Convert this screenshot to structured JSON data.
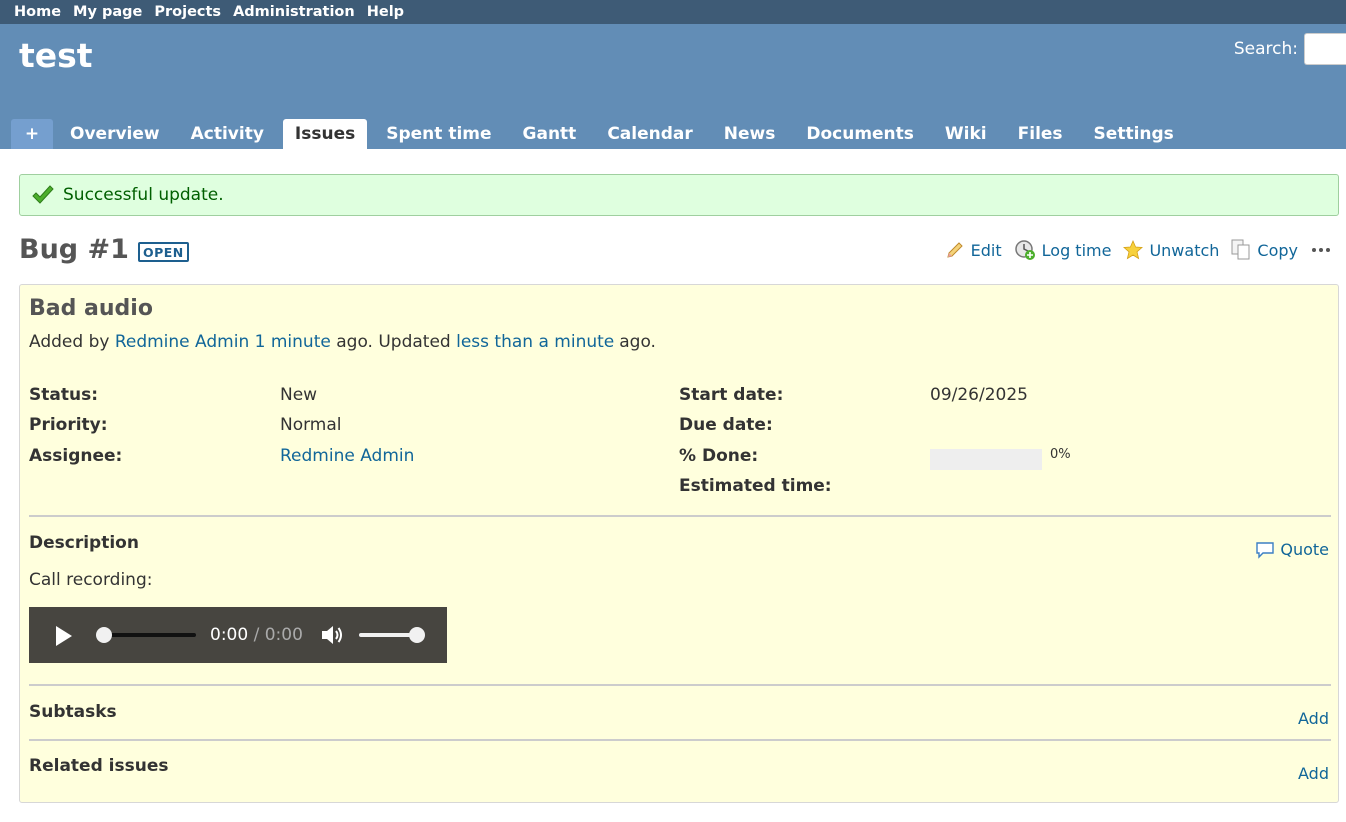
{
  "top_menu": [
    "Home",
    "My page",
    "Projects",
    "Administration",
    "Help"
  ],
  "project_title": "test",
  "search": {
    "label": "Search:"
  },
  "main_menu": {
    "new_label": "+",
    "tabs": [
      "Overview",
      "Activity",
      "Issues",
      "Spent time",
      "Gantt",
      "Calendar",
      "News",
      "Documents",
      "Wiki",
      "Files",
      "Settings"
    ],
    "selected": "Issues"
  },
  "flash": {
    "message": "Successful update."
  },
  "issue": {
    "title": "Bug #1",
    "status_badge": "OPEN",
    "subject": "Bad audio",
    "author": {
      "prefix": "Added by",
      "name": "Redmine Admin",
      "added_ago": "1 minute",
      "middle": "ago. Updated",
      "updated_ago": "less than a minute",
      "suffix": "ago."
    },
    "attributes_left": [
      {
        "label": "Status:",
        "value": "New",
        "link": false
      },
      {
        "label": "Priority:",
        "value": "Normal",
        "link": false
      },
      {
        "label": "Assignee:",
        "value": "Redmine Admin",
        "link": true
      }
    ],
    "attributes_right": [
      {
        "label": "Start date:",
        "value": "09/26/2025"
      },
      {
        "label": "Due date:",
        "value": ""
      },
      {
        "label": "% Done:",
        "value": "0%",
        "progress": 0
      },
      {
        "label": "Estimated time:",
        "value": ""
      }
    ],
    "description": {
      "title": "Description",
      "quote_label": "Quote",
      "text": "Call recording:"
    },
    "audio": {
      "current": "0:00",
      "separator": "/",
      "duration": "0:00",
      "progress": 0,
      "volume": 1
    },
    "subtasks": {
      "title": "Subtasks",
      "add_label": "Add"
    },
    "related": {
      "title": "Related issues",
      "add_label": "Add"
    }
  },
  "actions": {
    "edit": "Edit",
    "log_time": "Log time",
    "unwatch": "Unwatch",
    "copy": "Copy"
  },
  "colors": {
    "top_menu_bg": "#3e5b76",
    "header_bg": "#628db6",
    "issue_bg": "#ffffdd",
    "link": "#116699",
    "flash_bg": "#dfffdf"
  }
}
